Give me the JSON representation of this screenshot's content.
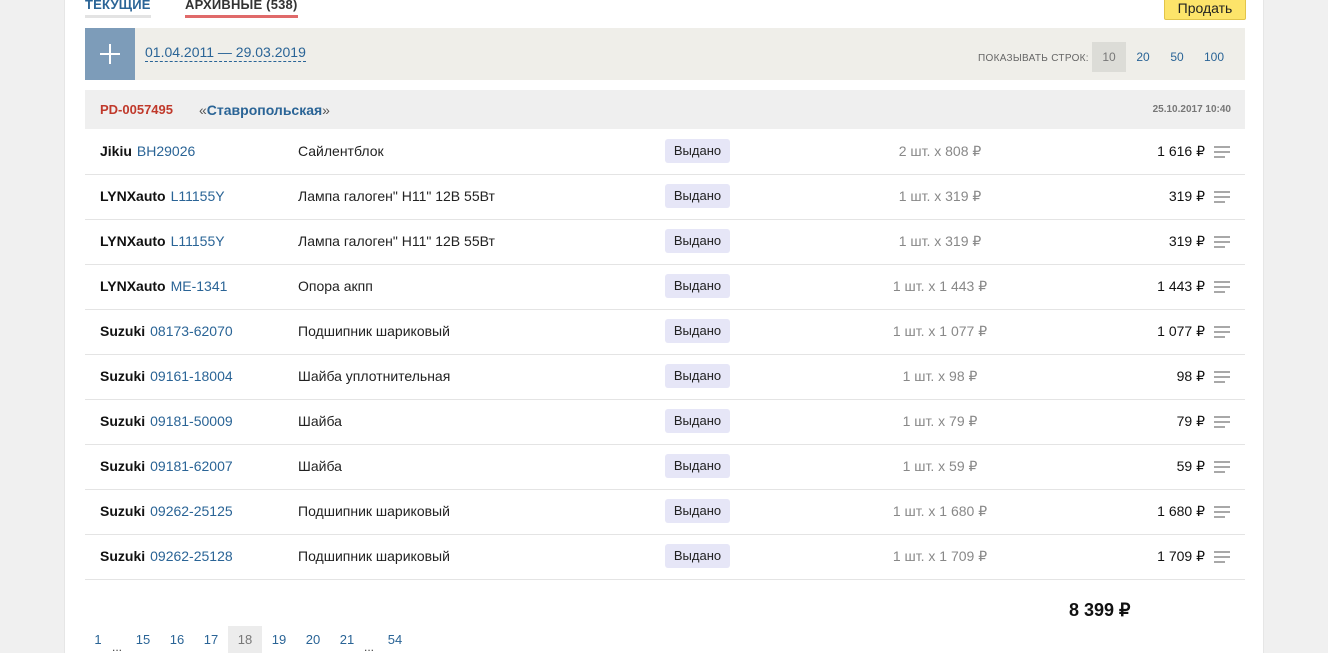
{
  "tabs": {
    "current": "ТЕКУЩИЕ",
    "archive": "АРХИВНЫЕ (538)"
  },
  "sell_button": "Продать",
  "filter": {
    "date_range": "01.04.2011 — 29.03.2019",
    "rows_label": "ПОКАЗЫВАТЬ СТРОК:",
    "rows_options": [
      "10",
      "20",
      "50",
      "100"
    ],
    "rows_selected": "10"
  },
  "order": {
    "id": "PD-0057495",
    "store_open_quote": "«",
    "store_name": "Ставропольская",
    "store_close_quote": "»",
    "date": "25.10.2017 10:40"
  },
  "items": [
    {
      "brand": "Jikiu",
      "code": "BH29026",
      "description": "Сайлентблок",
      "status": "Выдано",
      "qty": "2 шт. x 808 ₽",
      "sum": "1 616 ₽"
    },
    {
      "brand": "LYNXauto",
      "code": "L11155Y",
      "description": "Лампа галоген\" H11\" 12В 55Вт",
      "status": "Выдано",
      "qty": "1 шт. x 319 ₽",
      "sum": "319 ₽"
    },
    {
      "brand": "LYNXauto",
      "code": "L11155Y",
      "description": "Лампа галоген\" H11\" 12В 55Вт",
      "status": "Выдано",
      "qty": "1 шт. x 319 ₽",
      "sum": "319 ₽"
    },
    {
      "brand": "LYNXauto",
      "code": "ME-1341",
      "description": "Опора акпп",
      "status": "Выдано",
      "qty": "1 шт. x 1 443 ₽",
      "sum": "1 443 ₽"
    },
    {
      "brand": "Suzuki",
      "code": "08173-62070",
      "description": "Подшипник шариковый",
      "status": "Выдано",
      "qty": "1 шт. x 1 077 ₽",
      "sum": "1 077 ₽"
    },
    {
      "brand": "Suzuki",
      "code": "09161-18004",
      "description": "Шайба уплотнительная",
      "status": "Выдано",
      "qty": "1 шт. x 98 ₽",
      "sum": "98 ₽"
    },
    {
      "brand": "Suzuki",
      "code": "09181-50009",
      "description": "Шайба",
      "status": "Выдано",
      "qty": "1 шт. x 79 ₽",
      "sum": "79 ₽"
    },
    {
      "brand": "Suzuki",
      "code": "09181-62007",
      "description": "Шайба",
      "status": "Выдано",
      "qty": "1 шт. x 59 ₽",
      "sum": "59 ₽"
    },
    {
      "brand": "Suzuki",
      "code": "09262-25125",
      "description": "Подшипник шариковый",
      "status": "Выдано",
      "qty": "1 шт. x 1 680 ₽",
      "sum": "1 680 ₽"
    },
    {
      "brand": "Suzuki",
      "code": "09262-25128",
      "description": "Подшипник шариковый",
      "status": "Выдано",
      "qty": "1 шт. x 1 709 ₽",
      "sum": "1 709 ₽"
    }
  ],
  "total": "8 399 ₽",
  "pagination": {
    "pages": [
      "1",
      "15",
      "16",
      "17",
      "18",
      "19",
      "20",
      "21",
      "54"
    ],
    "current": "18",
    "ellipsis": "..."
  }
}
